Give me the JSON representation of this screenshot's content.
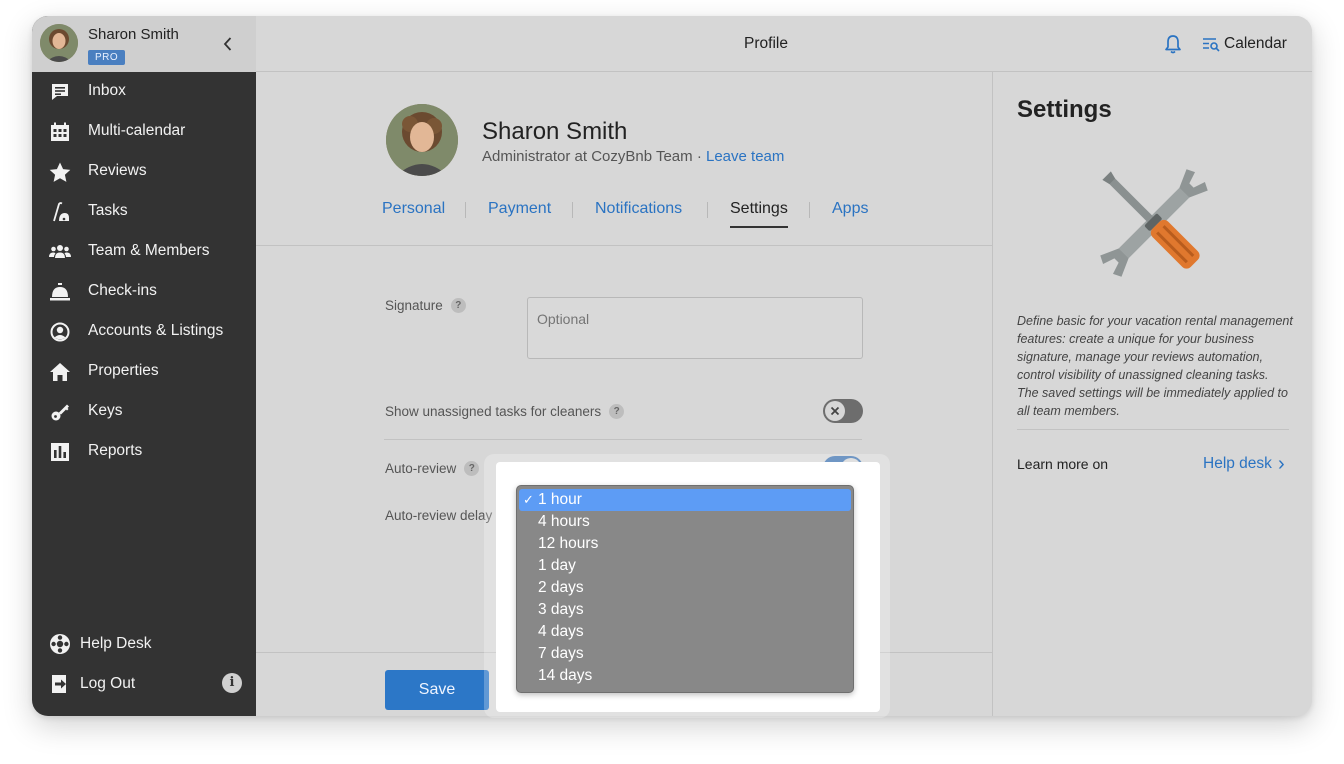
{
  "user": {
    "name": "Sharon Smith",
    "plan_badge": "PRO"
  },
  "sidebar": {
    "items": [
      {
        "label": "Inbox",
        "icon": "inbox-icon"
      },
      {
        "label": "Multi-calendar",
        "icon": "calendar-grid-icon"
      },
      {
        "label": "Reviews",
        "icon": "star-icon"
      },
      {
        "label": "Tasks",
        "icon": "vacuum-icon"
      },
      {
        "label": "Team & Members",
        "icon": "team-icon"
      },
      {
        "label": "Check-ins",
        "icon": "service-bell-icon"
      },
      {
        "label": "Accounts & Listings",
        "icon": "account-circle-icon"
      },
      {
        "label": "Properties",
        "icon": "home-icon"
      },
      {
        "label": "Keys",
        "icon": "key-icon"
      },
      {
        "label": "Reports",
        "icon": "bar-chart-icon"
      }
    ],
    "bottom": [
      {
        "label": "Help Desk",
        "icon": "lifebuoy-icon"
      },
      {
        "label": "Log Out",
        "icon": "logout-icon"
      }
    ],
    "info_glyph": "i"
  },
  "topbar": {
    "title": "Profile",
    "calendar_label": "Calendar"
  },
  "profile": {
    "name": "Sharon Smith",
    "role": "Administrator at CozyBnb Team",
    "separator": "·",
    "leave_label": "Leave team"
  },
  "tabs": [
    {
      "label": "Personal",
      "active": false
    },
    {
      "label": "Payment",
      "active": false
    },
    {
      "label": "Notifications",
      "active": false
    },
    {
      "label": "Settings",
      "active": true
    },
    {
      "label": "Apps",
      "active": false
    }
  ],
  "form": {
    "signature_label": "Signature",
    "signature_placeholder": "Optional",
    "help_glyph": "?",
    "unassigned_label": "Show unassigned tasks for cleaners",
    "unassigned_on": false,
    "auto_review_label": "Auto-review",
    "auto_review_on": true,
    "delay_label": "Auto-review delay",
    "save_label": "Save"
  },
  "dropdown": {
    "selected": "1 hour",
    "check_glyph": "✓",
    "options": [
      "1 hour",
      "4 hours",
      "12 hours",
      "1 day",
      "2 days",
      "3 days",
      "4 days",
      "7 days",
      "14 days"
    ]
  },
  "right_panel": {
    "title": "Settings",
    "description": "Define basic for your vacation rental management features: create a unique for your business signature, manage your reviews automation, control visibility of unassigned cleaning tasks. The saved settings will be immediately applied to all team members.",
    "learn_more": "Learn more on",
    "help_link": "Help desk",
    "help_chevron": "›"
  },
  "colors": {
    "accent": "#2a73c2",
    "sidebar_bg": "#333333",
    "selected_option": "#5d9cf5",
    "toggle_on": "#3f73b0"
  }
}
